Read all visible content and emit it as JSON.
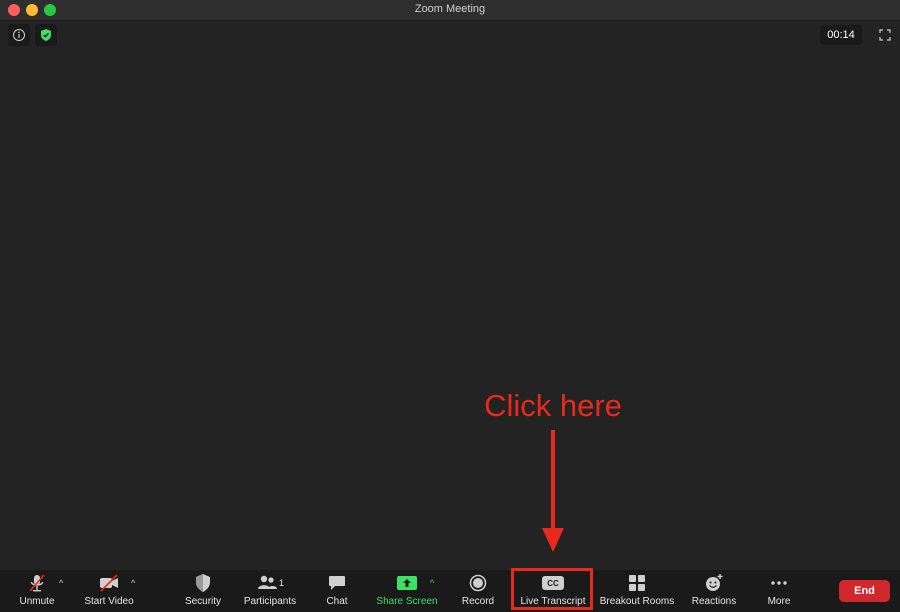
{
  "window": {
    "title": "Zoom Meeting"
  },
  "meeting": {
    "timer": "00:14"
  },
  "annotation": {
    "text": "Click here"
  },
  "toolbar": {
    "unmute_label": "Unmute",
    "start_video_label": "Start Video",
    "security_label": "Security",
    "participants_label": "Participants",
    "participants_count": "1",
    "chat_label": "Chat",
    "share_screen_label": "Share Screen",
    "record_label": "Record",
    "live_transcript_label": "Live Transcript",
    "cc_text": "CC",
    "breakout_rooms_label": "Breakout Rooms",
    "reactions_label": "Reactions",
    "more_label": "More",
    "end_label": "End"
  },
  "colors": {
    "background": "#232323",
    "toolbar": "#1a1a1a",
    "share_green": "#3ce363",
    "end_red": "#d0282c",
    "annotation_red": "#e8291c"
  }
}
